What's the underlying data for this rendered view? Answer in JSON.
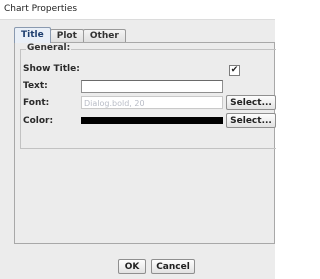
{
  "window": {
    "title": "Chart Properties"
  },
  "tabs": [
    {
      "label": "Title",
      "active": true
    },
    {
      "label": "Plot",
      "active": false
    },
    {
      "label": "Other",
      "active": false
    }
  ],
  "general": {
    "group_label": "General:",
    "show_title_label": "Show Title:",
    "show_title_checked": true,
    "show_title_mark": "✔",
    "text_label": "Text:",
    "text_value": "",
    "font_label": "Font:",
    "font_value": "Dialog.bold, 20",
    "font_select_label": "Select...",
    "color_label": "Color:",
    "color_value": "#000000",
    "color_select_label": "Select..."
  },
  "footer": {
    "ok_label": "OK",
    "cancel_label": "Cancel"
  }
}
